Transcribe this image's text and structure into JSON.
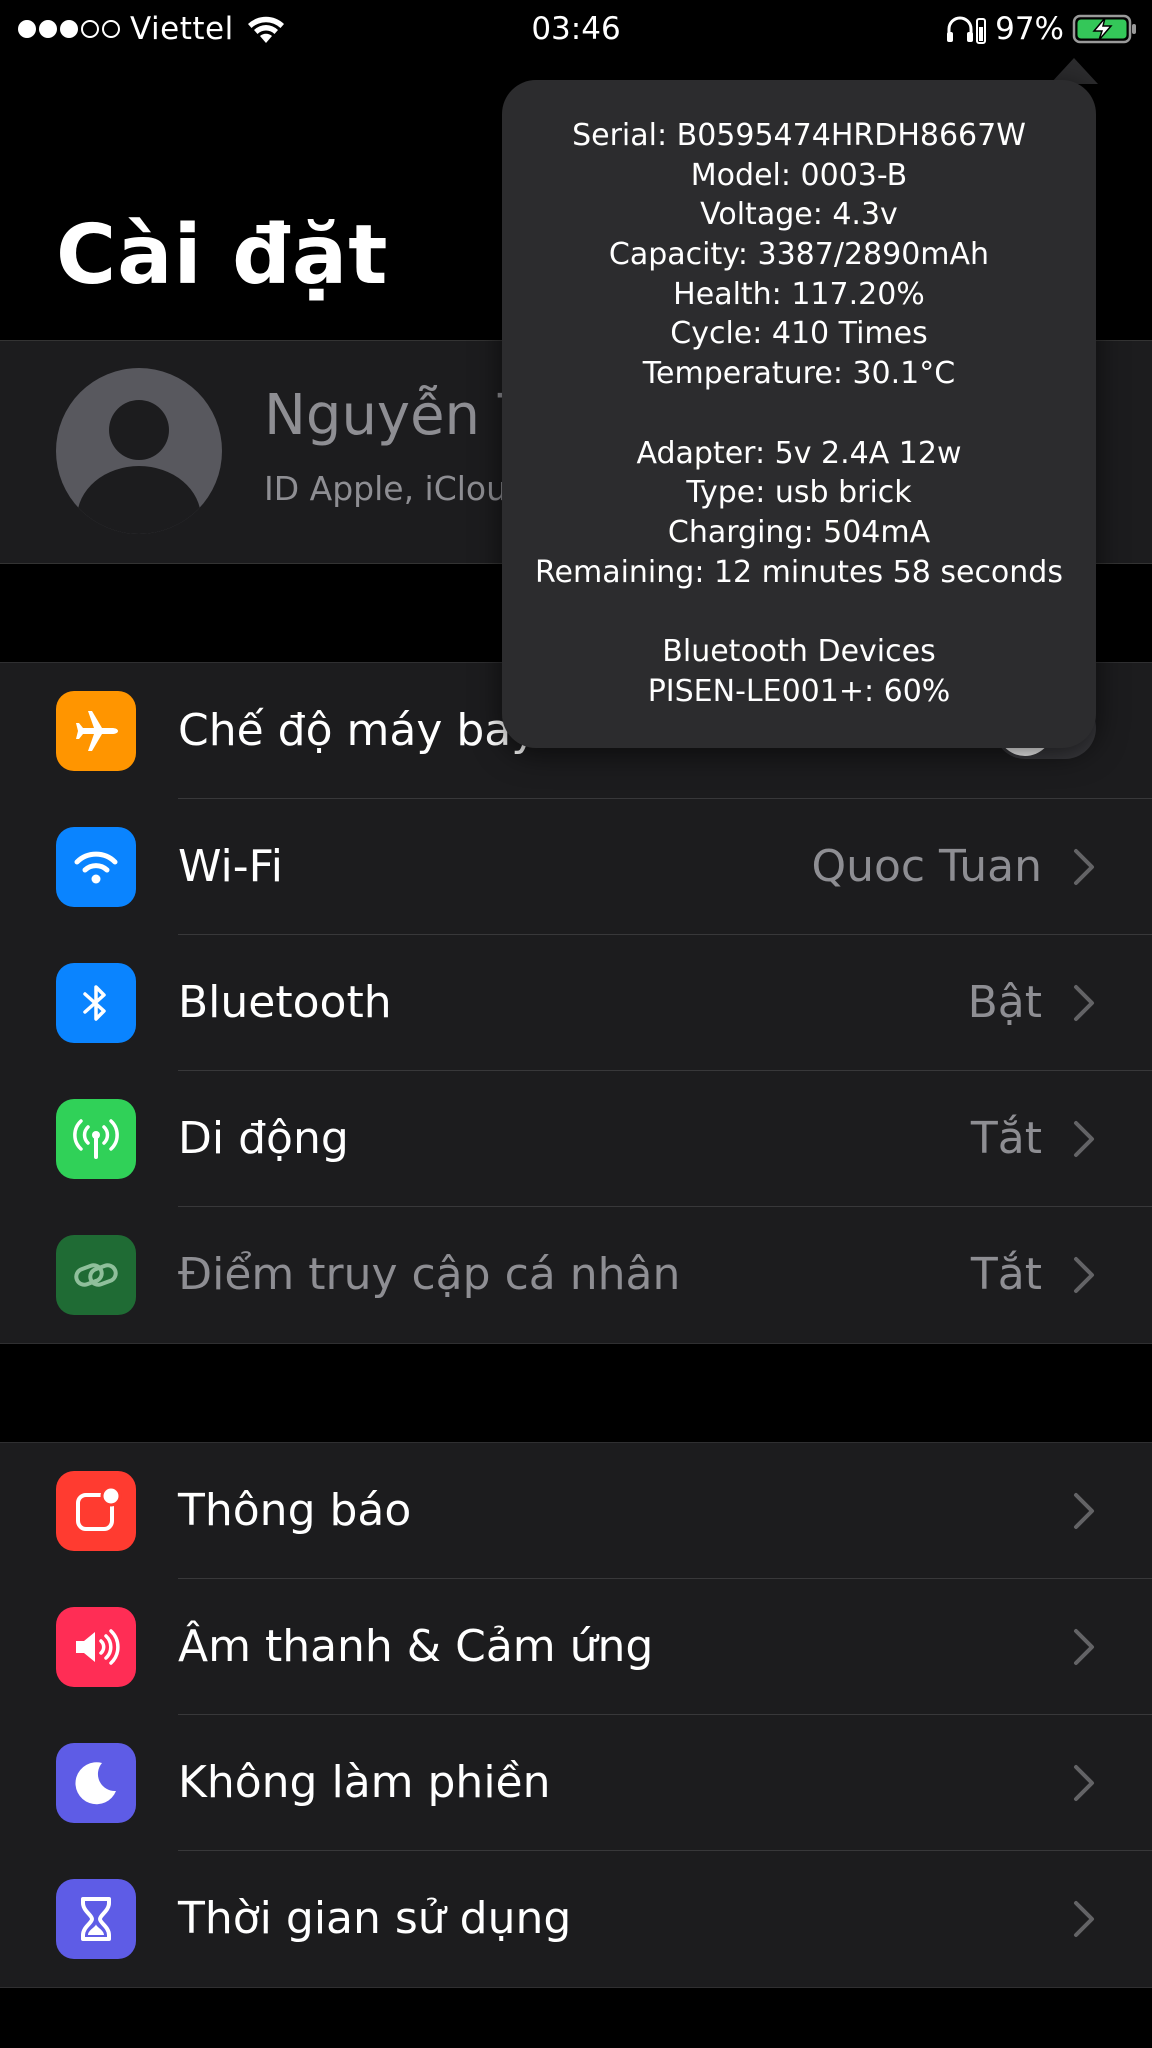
{
  "status_bar": {
    "carrier": "Viettel",
    "time": "03:46",
    "battery_percent": "97%",
    "signal_bars_filled": 3,
    "signal_bars_total": 5
  },
  "title": "Cài đặt",
  "profile": {
    "name": "Nguyễn T",
    "subtitle": "ID Apple, iClou"
  },
  "battery_popup": {
    "lines": [
      "Serial: B0595474HRDH8667W",
      "Model: 0003-B",
      "Voltage: 4.3v",
      "Capacity: 3387/2890mAh",
      "Health: 117.20%",
      "Cycle: 410 Times",
      "Temperature: 30.1°C",
      "",
      "Adapter: 5v 2.4A 12w",
      "Type: usb brick",
      "Charging: 504mA",
      "Remaining: 12 minutes 58 seconds",
      "",
      "Bluetooth Devices",
      "PISEN-LE001+: 60%"
    ]
  },
  "connectivity": [
    {
      "label": "Chế độ máy bay",
      "value": "",
      "icon": "airplane-icon",
      "color": "#ff9500"
    },
    {
      "label": "Wi-Fi",
      "value": "Quoc Tuan",
      "icon": "wifi-icon",
      "color": "#0a84ff"
    },
    {
      "label": "Bluetooth",
      "value": "Bật",
      "icon": "bluetooth-icon",
      "color": "#0a84ff"
    },
    {
      "label": "Di động",
      "value": "Tắt",
      "icon": "antenna-icon",
      "color": "#30d158"
    },
    {
      "label": "Điểm truy cập cá nhân",
      "value": "Tắt",
      "icon": "hotspot-link-icon",
      "color": "#1f6b34"
    }
  ],
  "notifications": [
    {
      "label": "Thông báo",
      "icon": "notification-badge-icon",
      "color": "#ff3b30"
    },
    {
      "label": "Âm thanh & Cảm ứng",
      "icon": "speaker-icon",
      "color": "#ff2d55"
    },
    {
      "label": "Không làm phiền",
      "icon": "moon-icon",
      "color": "#5e5ce6"
    },
    {
      "label": "Thời gian sử dụng",
      "icon": "hourglass-icon",
      "color": "#5e5ce6"
    }
  ]
}
